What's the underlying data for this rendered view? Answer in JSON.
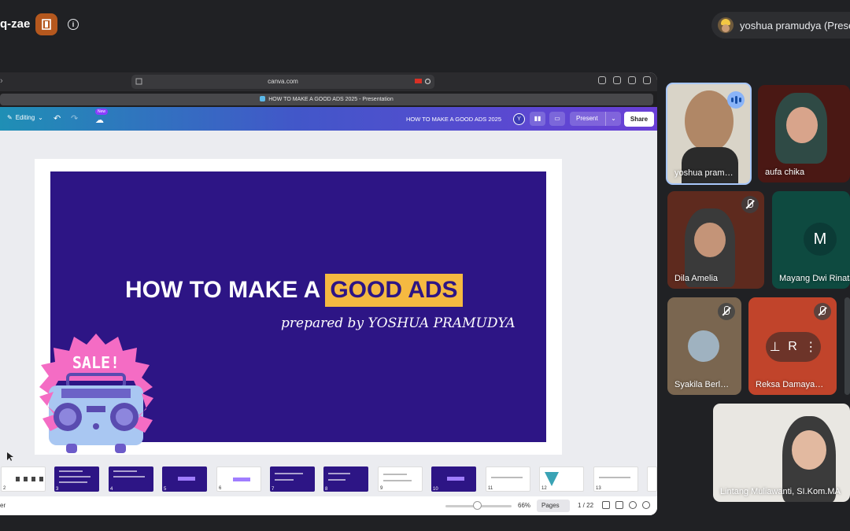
{
  "meet": {
    "room_name": "q-zae",
    "presenter_label": "yoshua pramudya (Presenting)"
  },
  "browser": {
    "url": "canva.com",
    "tab_title": "HOW TO MAKE A GOOD ADS 2025 - Presentation"
  },
  "canva": {
    "mode_label": "Editing",
    "new_badge": "New",
    "doc_title": "HOW TO MAKE A GOOD ADS 2025",
    "avatar_letter": "Y",
    "present_label": "Present",
    "share_label": "Share"
  },
  "slide": {
    "title_main": "HOW TO MAKE A",
    "title_highlight": "GOOD ADS",
    "subtitle": "prepared by YOSHUA PRAMUDYA",
    "sticker_text": "SALE!"
  },
  "thumbnails": [
    "2",
    "3",
    "4",
    "5",
    "6",
    "7",
    "8",
    "9",
    "10",
    "11",
    "12",
    "13"
  ],
  "status": {
    "left_label": "er",
    "zoom": "66%",
    "pages_label": "Pages",
    "page_count": "1 / 22"
  },
  "participants": [
    {
      "name": "yoshua pram…"
    },
    {
      "name": "aufa chika"
    },
    {
      "name": "Dila Amelia"
    },
    {
      "name": "Mayang Dwi Rinata",
      "initial": "M"
    },
    {
      "name": "Syakila Berl…"
    },
    {
      "name": "Reksa Damaya…",
      "initial": "R"
    },
    {
      "name": "Lintang Muliawanti, SI.Kom.MA"
    }
  ],
  "colors": {
    "meet_bg": "#202124",
    "slide_bg": "#2d1585",
    "highlight": "#f5b941",
    "canva_purple": "#8b3dff"
  }
}
